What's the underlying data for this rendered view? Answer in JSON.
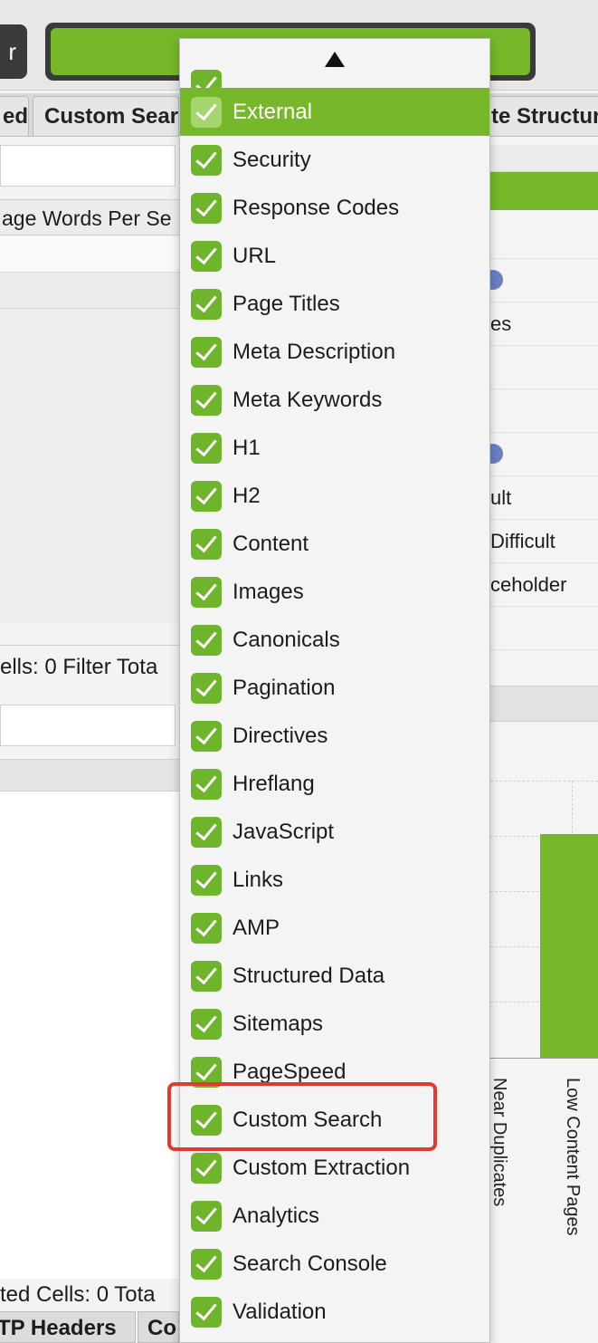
{
  "toolbar": {
    "partial_button_label": "r"
  },
  "tabs": [
    "ed",
    "Custom Sear",
    "te Structur"
  ],
  "left_pane": {
    "column_header": "age Words Per Se",
    "status_top": "ells:  0  Filter Tota",
    "status_bottom": "ted Cells:  0  Tota",
    "bottom_tabs": [
      "TP Headers",
      "Co"
    ]
  },
  "right_pane": {
    "rows": [
      "es",
      "ult",
      "Difficult",
      "ceholder"
    ],
    "chart_labels": [
      "Near Duplicates",
      "Low Content Pages"
    ]
  },
  "dropdown": {
    "scroll_up_icon": "triangle-up-icon",
    "items": [
      {
        "label": "",
        "checked": true
      },
      {
        "label": "External",
        "checked": true
      },
      {
        "label": "Security",
        "checked": true
      },
      {
        "label": "Response Codes",
        "checked": true
      },
      {
        "label": "URL",
        "checked": true
      },
      {
        "label": "Page Titles",
        "checked": true
      },
      {
        "label": "Meta Description",
        "checked": true
      },
      {
        "label": "Meta Keywords",
        "checked": true
      },
      {
        "label": "H1",
        "checked": true
      },
      {
        "label": "H2",
        "checked": true
      },
      {
        "label": "Content",
        "checked": true
      },
      {
        "label": "Images",
        "checked": true
      },
      {
        "label": "Canonicals",
        "checked": true
      },
      {
        "label": "Pagination",
        "checked": true
      },
      {
        "label": "Directives",
        "checked": true
      },
      {
        "label": "Hreflang",
        "checked": true
      },
      {
        "label": "JavaScript",
        "checked": true
      },
      {
        "label": "Links",
        "checked": true
      },
      {
        "label": "AMP",
        "checked": true
      },
      {
        "label": "Structured Data",
        "checked": true
      },
      {
        "label": "Sitemaps",
        "checked": true
      },
      {
        "label": "PageSpeed",
        "checked": true
      },
      {
        "label": "Custom Search",
        "checked": true
      },
      {
        "label": "Custom Extraction",
        "checked": true
      },
      {
        "label": "Analytics",
        "checked": true
      },
      {
        "label": "Search Console",
        "checked": true
      },
      {
        "label": "Validation",
        "checked": true
      }
    ],
    "selected_index": 1,
    "highlighted_label": "Custom Search"
  },
  "colors": {
    "accent_green": "#76b82a",
    "highlight_red": "#e23a2c",
    "dark_frame": "#3a3a3a"
  }
}
